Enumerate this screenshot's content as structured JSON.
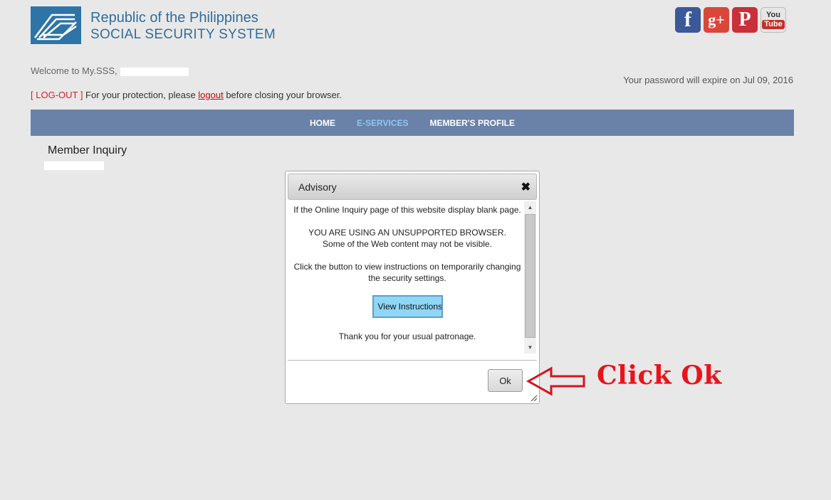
{
  "header": {
    "agency_line1": "Republic of the Philippines",
    "agency_line2": "SOCIAL SECURITY SYSTEM",
    "social_icons": [
      {
        "name": "facebook-icon",
        "glyph": "f"
      },
      {
        "name": "google-plus-icon",
        "glyph": "g+"
      },
      {
        "name": "pinterest-icon",
        "glyph": "P"
      },
      {
        "name": "youtube-icon",
        "glyph_top": "You",
        "glyph_bottom": "Tube"
      }
    ]
  },
  "user_bar": {
    "welcome_text": "Welcome to My.SSS,",
    "password_expire": "Your password will expire on Jul 09, 2016",
    "logout_bracket": "[ LOG-OUT ]",
    "logout_prefix": " For your protection, please ",
    "logout_link": "logout",
    "logout_suffix": " before closing your browser."
  },
  "nav": {
    "items": [
      {
        "label": "HOME",
        "active": false
      },
      {
        "label": "E-SERVICES",
        "active": true
      },
      {
        "label": "MEMBER'S PROFILE",
        "active": false
      }
    ]
  },
  "main": {
    "section_title": "Member Inquiry"
  },
  "dialog": {
    "title": "Advisory",
    "close_glyph": "✖",
    "line1": "If the Online Inquiry page of this website display blank page.",
    "line2a": "YOU ARE USING AN UNSUPPORTED BROWSER.",
    "line2b": "Some of the Web content may not be visible.",
    "line3": "Click the button to view instructions on temporarily changing the security settings.",
    "view_button": "View Instructions",
    "thanks": "Thank you for your usual patronage.",
    "ok_button": "Ok"
  },
  "annotation": {
    "text": "Click Ok",
    "color": "#e8141c"
  }
}
